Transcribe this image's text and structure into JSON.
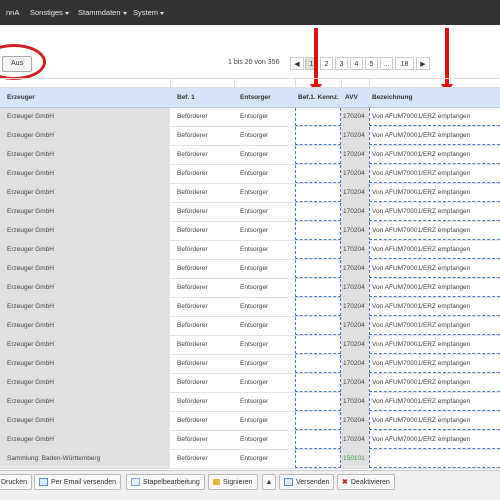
{
  "nav": {
    "items": [
      {
        "label": "nnA",
        "has_caret": false
      },
      {
        "label": "Sonstiges",
        "has_caret": true
      },
      {
        "label": "Stammdaten",
        "has_caret": true
      },
      {
        "label": "System",
        "has_caret": true
      }
    ]
  },
  "filter": {
    "aus_label": "Aus"
  },
  "pagination": {
    "info": "1 bis 20 von 356",
    "pages": [
      "1",
      "2",
      "3",
      "4",
      "5",
      "...",
      "18"
    ],
    "current": "1"
  },
  "table": {
    "columns": {
      "erzeuger": "Erzeuger",
      "bef1": "Bef. 1",
      "entsorger": "Entsorger",
      "bef1_kennz": "Bef.1. Kennz.",
      "avv": "AVV",
      "bezeichnung": "Bezeichnung"
    },
    "rows": [
      {
        "erzeuger": "Erzeuger GmbH",
        "bef1": "Beförderer",
        "entsorger": "Entsorger",
        "kennz": "",
        "avv": "170204",
        "bezeichnung": "Von AFUM70001/ERZ empfangen"
      },
      {
        "erzeuger": "Erzeuger GmbH",
        "bef1": "Beförderer",
        "entsorger": "Entsorger",
        "kennz": "",
        "avv": "170204",
        "bezeichnung": "Von AFUM70001/ERZ empfangen"
      },
      {
        "erzeuger": "Erzeuger GmbH",
        "bef1": "Beförderer",
        "entsorger": "Entsorger",
        "kennz": "",
        "avv": "170204",
        "bezeichnung": "Von AFUM70001/ERZ empfangen"
      },
      {
        "erzeuger": "Erzeuger GmbH",
        "bef1": "Beförderer",
        "entsorger": "Entsorger",
        "kennz": "",
        "avv": "170204",
        "bezeichnung": "Von AFUM70001/ERZ empfangen"
      },
      {
        "erzeuger": "Erzeuger GmbH",
        "bef1": "Beförderer",
        "entsorger": "Entsorger",
        "kennz": "",
        "avv": "170204",
        "bezeichnung": "Von AFUM70001/ERZ empfangen"
      },
      {
        "erzeuger": "Erzeuger GmbH",
        "bef1": "Beförderer",
        "entsorger": "Entsorger",
        "kennz": "",
        "avv": "170204",
        "bezeichnung": "Von AFUM70001/ERZ empfangen"
      },
      {
        "erzeuger": "Erzeuger GmbH",
        "bef1": "Beförderer",
        "entsorger": "Entsorger",
        "kennz": "",
        "avv": "170204",
        "bezeichnung": "Von AFUM70001/ERZ empfangen"
      },
      {
        "erzeuger": "Erzeuger GmbH",
        "bef1": "Beförderer",
        "entsorger": "Entsorger",
        "kennz": "",
        "avv": "170204",
        "bezeichnung": "Von AFUM70001/ERZ empfangen"
      },
      {
        "erzeuger": "Erzeuger GmbH",
        "bef1": "Beförderer",
        "entsorger": "Entsorger",
        "kennz": "",
        "avv": "170204",
        "bezeichnung": "Von AFUM70001/ERZ empfangen"
      },
      {
        "erzeuger": "Erzeuger GmbH",
        "bef1": "Beförderer",
        "entsorger": "Entsorger",
        "kennz": "",
        "avv": "170204",
        "bezeichnung": "Von AFUM70001/ERZ empfangen"
      },
      {
        "erzeuger": "Erzeuger GmbH",
        "bef1": "Beförderer",
        "entsorger": "Entsorger",
        "kennz": "",
        "avv": "170204",
        "bezeichnung": "Von AFUM70001/ERZ empfangen"
      },
      {
        "erzeuger": "Erzeuger GmbH",
        "bef1": "Beförderer",
        "entsorger": "Entsorger",
        "kennz": "",
        "avv": "170204",
        "bezeichnung": "Von AFUM70001/ERZ empfangen"
      },
      {
        "erzeuger": "Erzeuger GmbH",
        "bef1": "Beförderer",
        "entsorger": "Entsorger",
        "kennz": "",
        "avv": "170204",
        "bezeichnung": "Von AFUM70001/ERZ empfangen"
      },
      {
        "erzeuger": "Erzeuger GmbH",
        "bef1": "Beförderer",
        "entsorger": "Entsorger",
        "kennz": "",
        "avv": "170204",
        "bezeichnung": "Von AFUM70001/ERZ empfangen"
      },
      {
        "erzeuger": "Erzeuger GmbH",
        "bef1": "Beförderer",
        "entsorger": "Entsorger",
        "kennz": "",
        "avv": "170204",
        "bezeichnung": "Von AFUM70001/ERZ empfangen"
      },
      {
        "erzeuger": "Erzeuger GmbH",
        "bef1": "Beförderer",
        "entsorger": "Entsorger",
        "kennz": "",
        "avv": "170204",
        "bezeichnung": "Von AFUM70001/ERZ empfangen"
      },
      {
        "erzeuger": "Erzeuger GmbH",
        "bef1": "Beförderer",
        "entsorger": "Entsorger",
        "kennz": "",
        "avv": "170204",
        "bezeichnung": "Von AFUM70001/ERZ empfangen"
      },
      {
        "erzeuger": "Erzeuger GmbH",
        "bef1": "Beförderer",
        "entsorger": "Entsorger",
        "kennz": "",
        "avv": "170204",
        "bezeichnung": "Von AFUM70001/ERZ empfangen"
      },
      {
        "erzeuger": "Sammlung: Baden-Württemberg",
        "bef1": "Beförderer",
        "entsorger": "Entsorger",
        "kennz": "",
        "avv": "150101",
        "avv_green": true,
        "bezeichnung": ""
      }
    ]
  },
  "toolbar": {
    "drucken": "Drucken",
    "email": "Per Email versenden",
    "stapel": "Stapelbearbeitung",
    "signieren": "Signieren",
    "versenden": "Versenden",
    "deaktivieren": "Deaktivieren"
  },
  "colors": {
    "navbar": "#333333",
    "header": "#d6e4f7",
    "annotation_red": "#e01010",
    "dashed_blue": "#4a7fd0",
    "green_text": "#3c9a3c"
  }
}
